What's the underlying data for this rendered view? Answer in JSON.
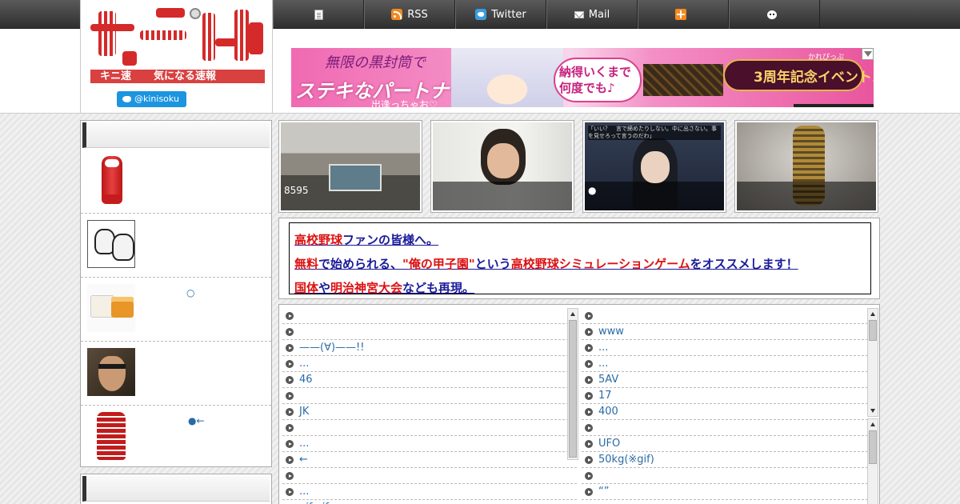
{
  "nav": {
    "items": [
      {
        "label": "",
        "icon": "page-icon"
      },
      {
        "label": "RSS",
        "icon": "rss-icon"
      },
      {
        "label": "Twitter",
        "icon": "twitter-icon"
      },
      {
        "label": "Mail",
        "icon": "mail-icon"
      },
      {
        "label": "",
        "icon": "hatena-icon"
      },
      {
        "label": "",
        "icon": "face-icon"
      }
    ]
  },
  "logo": {
    "band_left": "キニ速",
    "band_right": "気になる速報",
    "follow_label": "@kinisoku"
  },
  "banner": {
    "line1": "無限の黒封筒で",
    "line2": "ステキなパートナーと",
    "line3": "出逢っちゃお♡",
    "bubble_line1": "納得いくまで",
    "bubble_line2": "何度でも♪",
    "badge": "3周年記念イベント♪",
    "badge_small": "かれぴっぷ"
  },
  "sidebar": {
    "items": [
      {
        "title": "",
        "thumb": "cup"
      },
      {
        "title": "",
        "thumb": "manga"
      },
      {
        "title": "○",
        "thumb": "tofu"
      },
      {
        "title": "",
        "thumb": "snake"
      },
      {
        "title": "●←",
        "thumb": "cup2"
      }
    ]
  },
  "thumbs": [
    {
      "caption": "8595"
    },
    {
      "caption": ""
    },
    {
      "caption": "●",
      "dialog": "「いい？　言で締めたりしない。中に出さない。事を見せろって言うのだわ」"
    },
    {
      "caption": ""
    }
  ],
  "promo": {
    "line1": [
      {
        "t": "高校野球",
        "c": "r"
      },
      {
        "t": "ファンの皆様へ。",
        "c": "b"
      }
    ],
    "line2": [
      {
        "t": "無料",
        "c": "r"
      },
      {
        "t": "で始められる、",
        "c": "b"
      },
      {
        "t": "\"俺の甲子園\"",
        "c": "r"
      },
      {
        "t": "という",
        "c": "b"
      },
      {
        "t": "高校野球シミュレーションゲーム",
        "c": "r"
      },
      {
        "t": "をオススメします！",
        "c": "b"
      }
    ],
    "line3": [
      {
        "t": "国体",
        "c": "r"
      },
      {
        "t": "や",
        "c": "b"
      },
      {
        "t": "明治神宮大会",
        "c": "r"
      },
      {
        "t": "なども再現。",
        "c": "b"
      }
    ]
  },
  "lists": {
    "left": [
      "",
      "",
      "——(∀)——!!",
      "...",
      "46",
      "",
      "JK",
      "",
      "...",
      "←",
      "",
      "...",
      "gif gif"
    ],
    "right": [
      "",
      "www",
      "...",
      "...",
      "5AV",
      "17",
      "400",
      "",
      "UFO",
      "50kg(※gif)",
      "",
      "“”",
      ""
    ]
  }
}
